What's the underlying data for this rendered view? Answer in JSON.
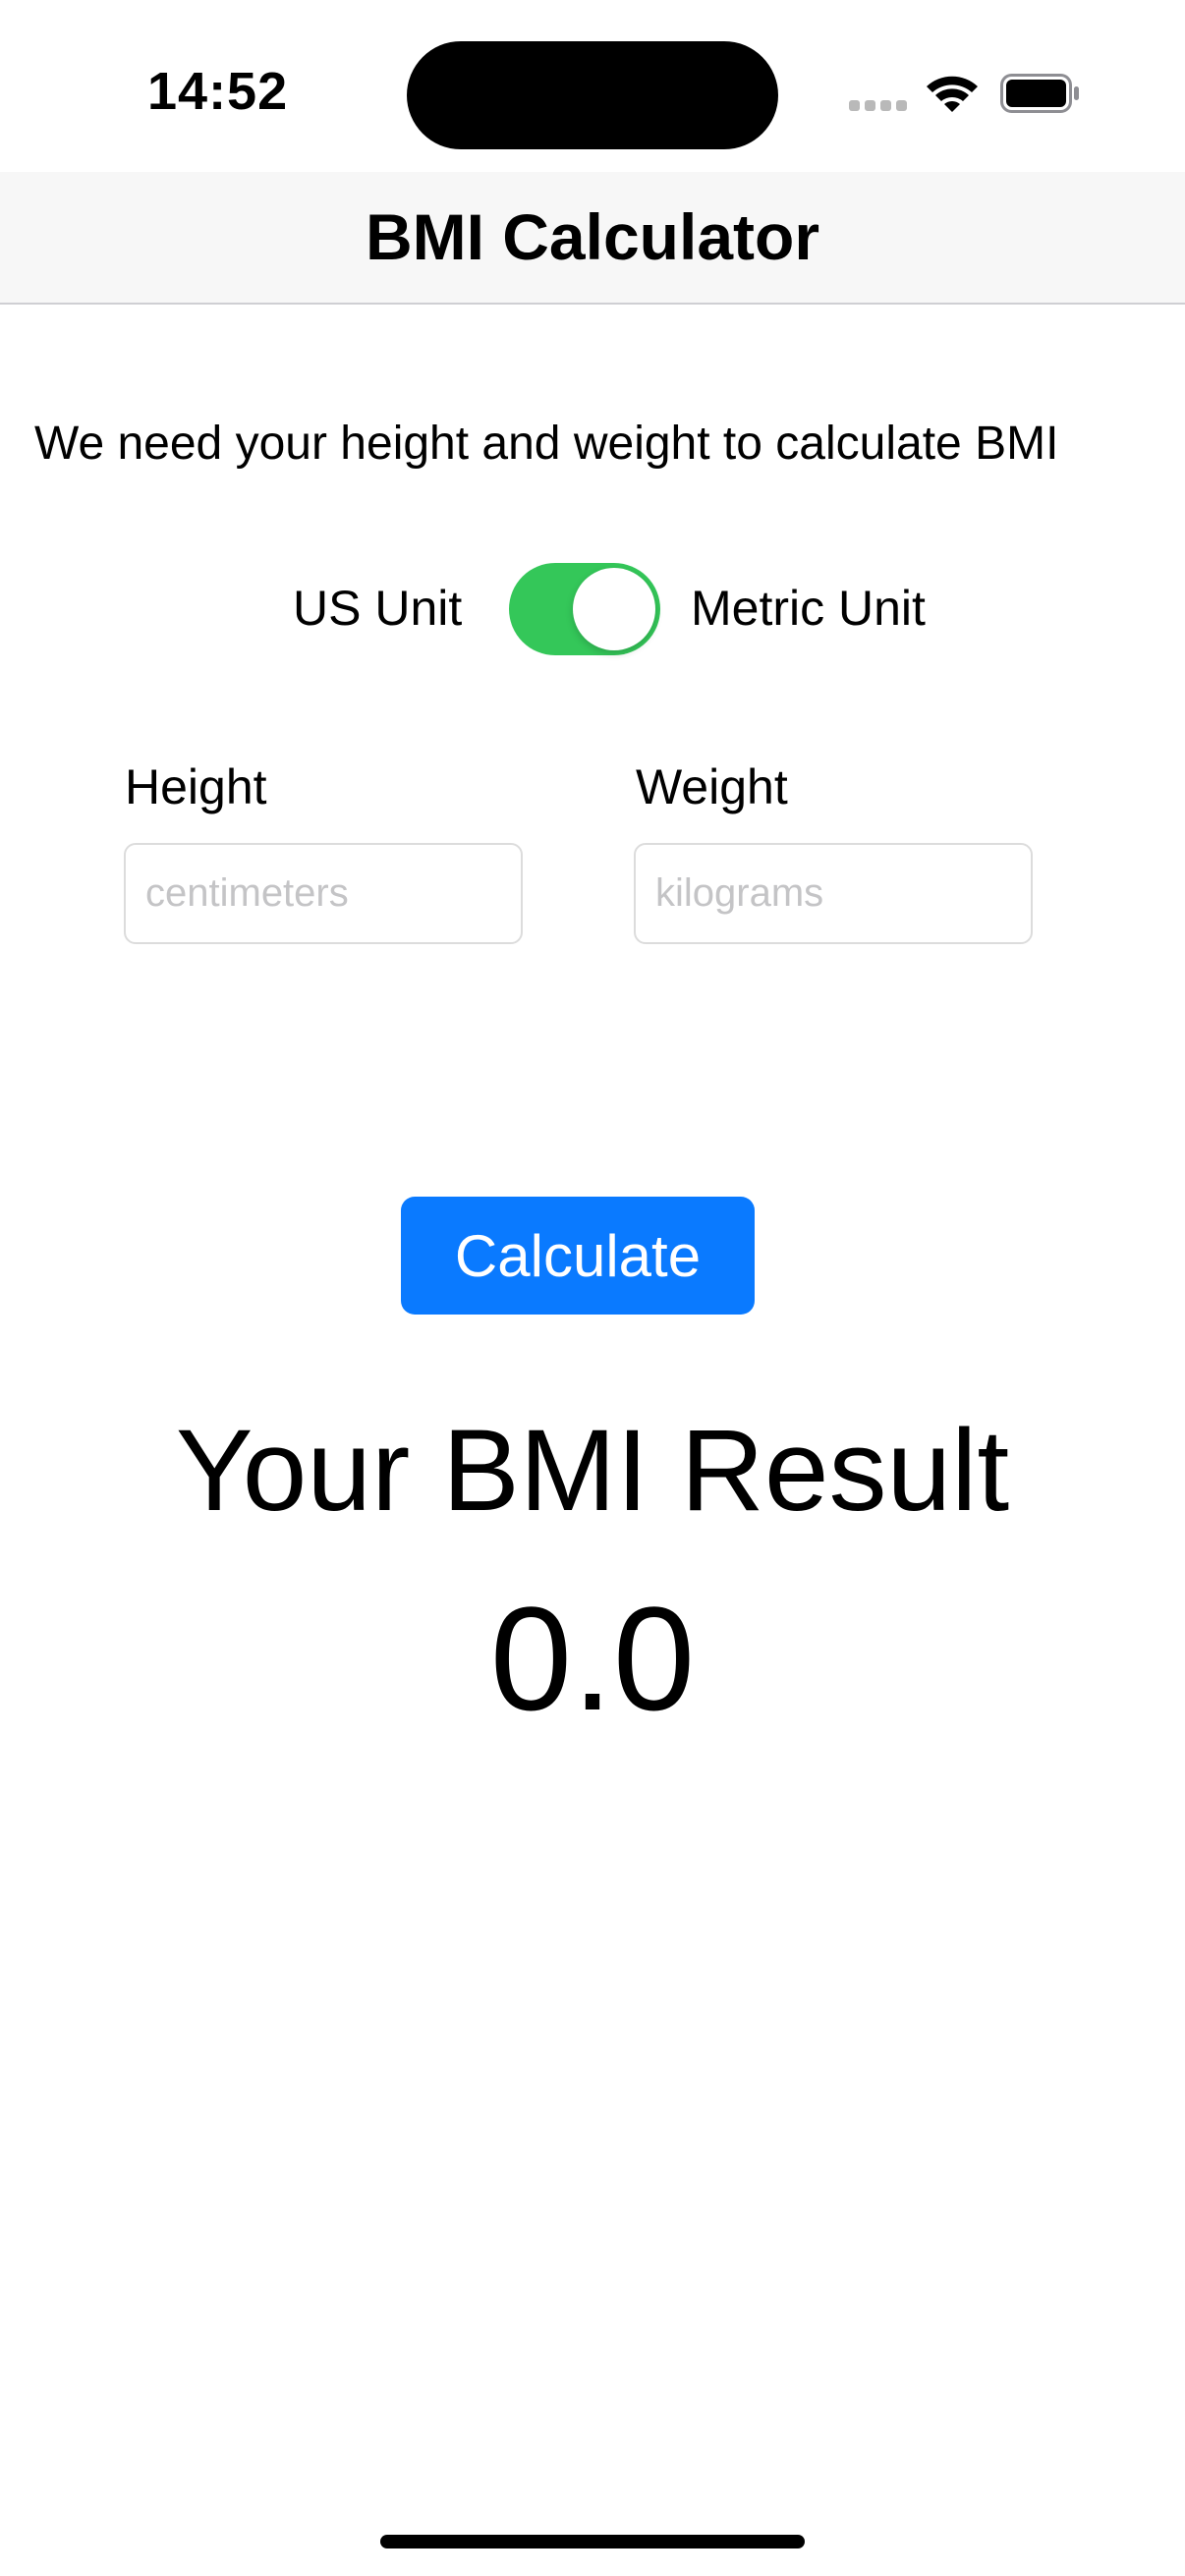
{
  "status_bar": {
    "time": "14:52",
    "icons": [
      "cellular-signal-icon",
      "wifi-icon",
      "battery-icon"
    ]
  },
  "nav": {
    "title": "BMI Calculator"
  },
  "instruction": "We need your height and weight to calculate BMI",
  "units": {
    "left_label": "US Unit",
    "right_label": "Metric Unit",
    "metric_selected": true,
    "toggle_color": "#34c759"
  },
  "fields": {
    "height": {
      "label": "Height",
      "placeholder": "centimeters",
      "value": ""
    },
    "weight": {
      "label": "Weight",
      "placeholder": "kilograms",
      "value": ""
    }
  },
  "calculate_button": {
    "label": "Calculate",
    "color": "#0a7aff"
  },
  "result": {
    "title": "Your BMI Result",
    "value": "0.0"
  }
}
